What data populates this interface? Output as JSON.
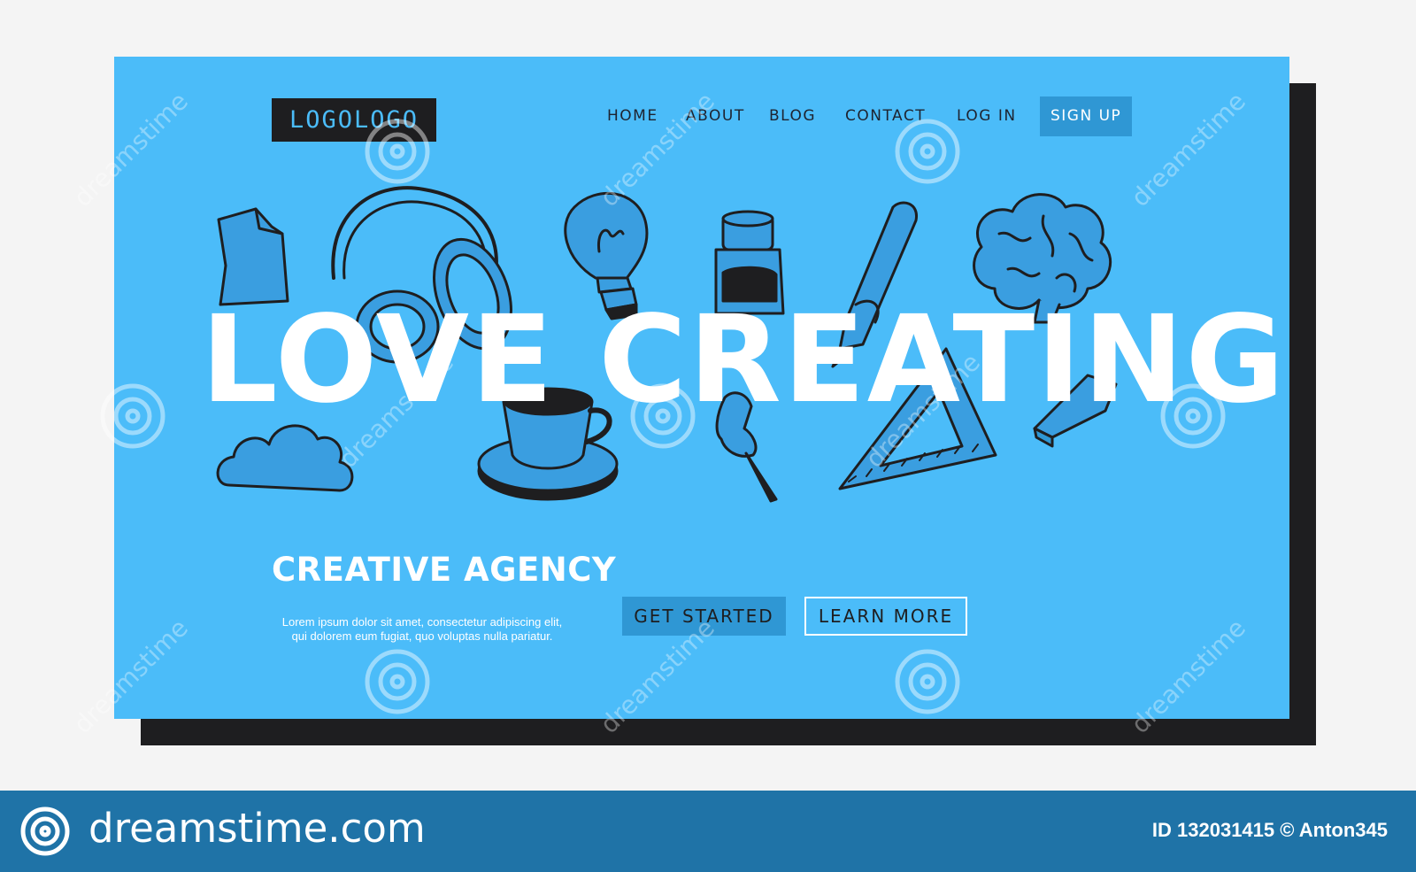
{
  "colors": {
    "page_bg": "#f4f4f4",
    "card_bg": "#4bbcf9",
    "shadow": "#1e1e20",
    "accent": "#2f97d4",
    "doodle_fill": "#3a9ee0",
    "footer_bg": "#1f73a7",
    "text_light": "#ffffff",
    "text_dark": "#1e2330"
  },
  "header": {
    "logo": "LOGOLOGO",
    "nav": [
      "HOME",
      "ABOUT",
      "BLOG",
      "CONTACT",
      "LOG IN"
    ],
    "signup": "SIGN UP"
  },
  "hero": {
    "title": "LOVE CREATING!",
    "doodles": [
      "paper-icon",
      "headphones-icon",
      "lightbulb-icon",
      "ink-bottle-icon",
      "pen-icon",
      "brain-icon",
      "cloud-icon",
      "coffee-cup-icon",
      "pushpin-icon",
      "triangle-ruler-icon",
      "eraser-icon"
    ]
  },
  "agency": {
    "title": "CREATIVE AGENCY",
    "desc_line1": "Lorem ipsum dolor sit amet, consectetur adipiscing elit,",
    "desc_line2": "qui dolorem eum fugiat, quo voluptas nulla pariatur."
  },
  "buttons": {
    "primary": "GET STARTED",
    "secondary": "LEARN MORE"
  },
  "watermark": {
    "text": "dreamstime"
  },
  "footer": {
    "brand": "dreamstime.com",
    "id_text": "ID 132031415 © Anton345"
  }
}
